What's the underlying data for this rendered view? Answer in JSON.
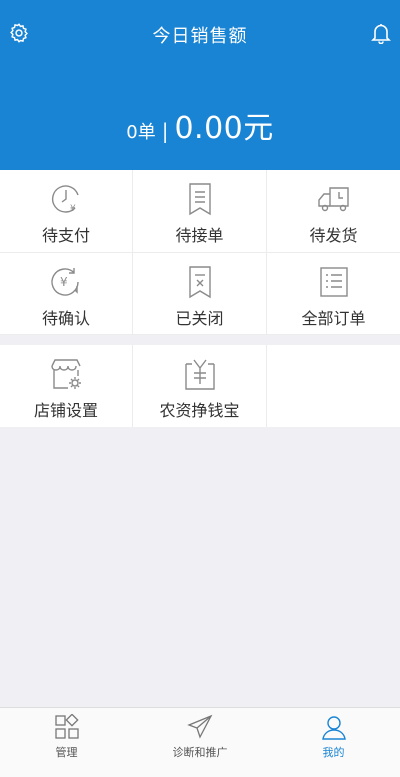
{
  "header": {
    "title": "今日销售额",
    "orders": "0单",
    "separator": "|",
    "amount": "0.00元",
    "settings_icon": "gear-icon",
    "bell_icon": "bell-icon"
  },
  "orders_grid": {
    "items": [
      {
        "label": "待支付",
        "icon": "pending-payment-icon"
      },
      {
        "label": "待接单",
        "icon": "pending-accept-icon"
      },
      {
        "label": "待发货",
        "icon": "truck-icon"
      },
      {
        "label": "待确认",
        "icon": "pending-confirm-icon"
      },
      {
        "label": "已关闭",
        "icon": "closed-order-icon"
      },
      {
        "label": "全部订单",
        "icon": "all-orders-icon"
      }
    ]
  },
  "tools_grid": {
    "items": [
      {
        "label": "店铺设置",
        "icon": "shop-settings-icon"
      },
      {
        "label": "农资挣钱宝",
        "icon": "money-box-icon"
      }
    ]
  },
  "tabbar": {
    "items": [
      {
        "label": "管理",
        "icon": "grid-icon"
      },
      {
        "label": "诊断和推广",
        "icon": "paper-plane-icon"
      },
      {
        "label": "我的",
        "icon": "user-icon"
      }
    ],
    "active": "我的"
  },
  "colors": {
    "brand": "#1a84d4",
    "icon_gray": "#8a8a8a",
    "background": "#efeff4"
  }
}
